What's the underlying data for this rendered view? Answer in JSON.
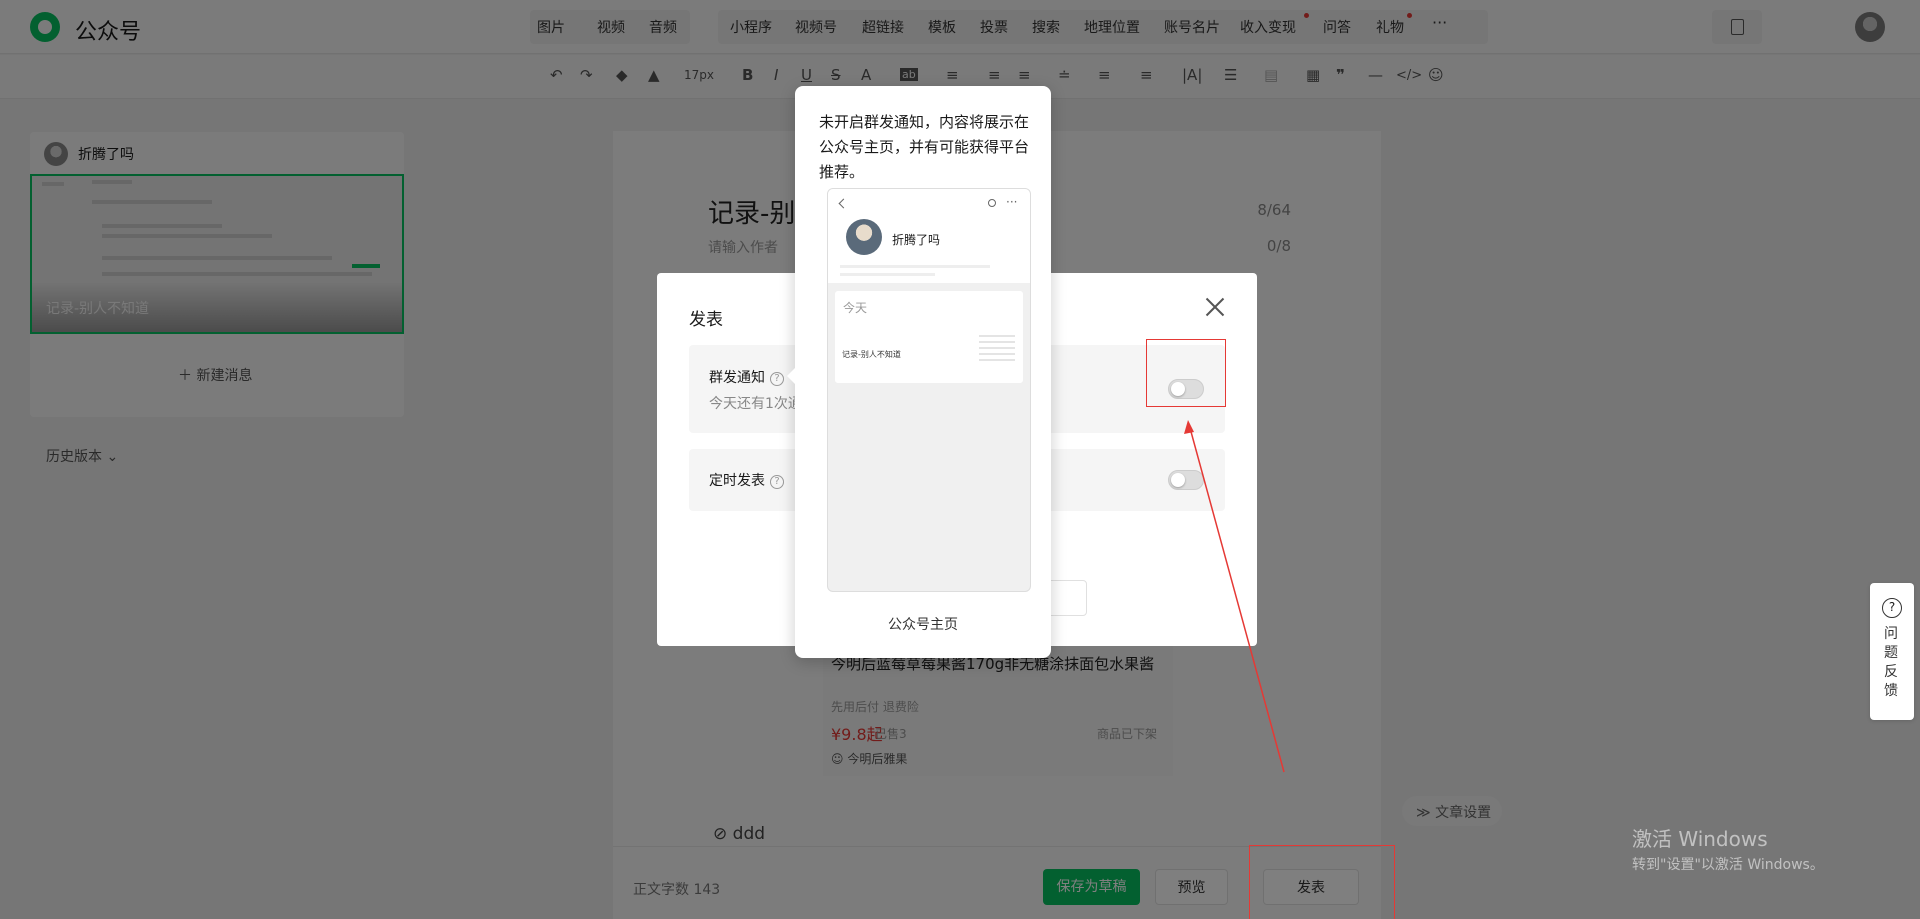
{
  "brand": "公众号",
  "topnav": {
    "items": [
      "图片",
      "视频",
      "音频",
      "小程序",
      "视频号",
      "超链接",
      "模板",
      "投票",
      "搜索",
      "地理位置",
      "账号名片",
      "收入变现",
      "问答",
      "礼物"
    ],
    "more": "···"
  },
  "toolbar": {
    "font_size": "17px"
  },
  "sidebar": {
    "account_name": "折腾了吗",
    "thumb_title": "记录-别人不知道",
    "new_message": "新建消息",
    "history": "历史版本"
  },
  "article": {
    "title": "记录-别人",
    "title_count": "8/64",
    "author_placeholder": "请输入作者",
    "author_count": "0/8",
    "product": {
      "title": "今明后蓝莓草莓果酱170g非无糖涂抹面包水果酱",
      "sub": "先用后付  退费险",
      "price": "¥9.8起",
      "sold": "已售3",
      "status": "商品已下架",
      "shop": "今明后雅果"
    },
    "tag": "ddd",
    "settings": "文章设置"
  },
  "bottom": {
    "wordcount_label": "正文字数",
    "wordcount": "143",
    "save_draft": "保存为草稿",
    "preview": "预览",
    "publish": "发表"
  },
  "modal": {
    "title": "发表",
    "mass_notify": "群发通知",
    "mass_sub": "今天还有1次通",
    "scheduled": "定时发表",
    "help": "?"
  },
  "popover": {
    "text": "未开启群发通知，内容将展示在公众号主页，并有可能获得平台推荐。",
    "account_name": "折腾了吗",
    "today": "今天",
    "item": "记录-别人不知道",
    "caption": "公众号主页"
  },
  "feedback": {
    "icon": "?",
    "label": "问题反馈"
  },
  "watermark": {
    "line1": "激活 Windows",
    "line2": "转到\"设置\"以激活 Windows。"
  },
  "colors": {
    "accent": "#07c160",
    "annotation": "#e53935"
  }
}
